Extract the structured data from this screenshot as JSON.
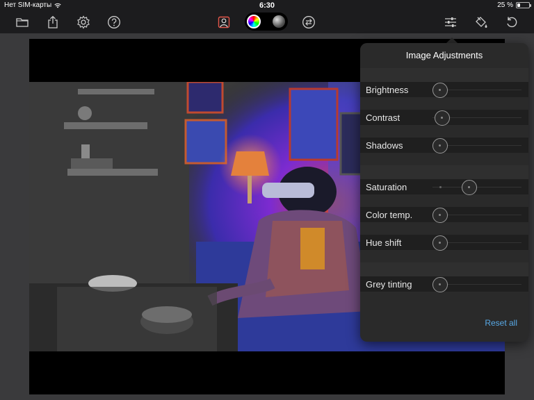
{
  "status_bar": {
    "carrier": "Нет SIM-карты",
    "time": "6:30",
    "battery_text": "25 %",
    "battery_level": 0.25
  },
  "toolbar": {
    "left_icons": [
      "folder-icon",
      "share-icon",
      "gear-icon",
      "help-icon"
    ],
    "center_icons": [
      "portrait-mask-icon",
      "color-wheel-icon",
      "monochrome-icon",
      "swap-icon"
    ],
    "right_icons": [
      "sliders-icon",
      "paint-bucket-icon",
      "undo-icon"
    ]
  },
  "adjustments": {
    "title": "Image Adjustments",
    "reset_label": "Reset all",
    "accent_color": "#58a9e6",
    "items": [
      {
        "label": "Brightness",
        "value": 0.0
      },
      {
        "label": "Contrast",
        "value": 0.03
      },
      {
        "label": "Shadows",
        "value": 0.0
      },
      {
        "label": "Saturation",
        "value": 0.4
      },
      {
        "label": "Color temp.",
        "value": 0.0
      },
      {
        "label": "Hue shift",
        "value": 0.0
      },
      {
        "label": "Grey tinting",
        "value": 0.0
      }
    ]
  }
}
